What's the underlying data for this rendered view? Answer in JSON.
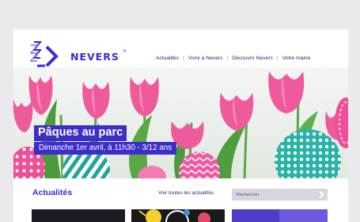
{
  "site": {
    "name": "NEVERS",
    "name_suffix": "fr",
    "brand_color": "#3b2bd6"
  },
  "nav": {
    "items": [
      "Actualités",
      "Vivre à Nevers",
      "Découvrir Nevers",
      "Votre mairie"
    ],
    "separator": "|"
  },
  "hero": {
    "title": "Pâques au parc",
    "subtitle": "Dimanche 1er avril, à 11h30 - 3/12 ans",
    "label_bg": "#3d2ec9"
  },
  "news": {
    "heading": "Actualités",
    "see_all": "Voir toutes les actualités"
  },
  "search": {
    "placeholder": "Rechercher",
    "button_icon": "chevron-right-icon"
  }
}
